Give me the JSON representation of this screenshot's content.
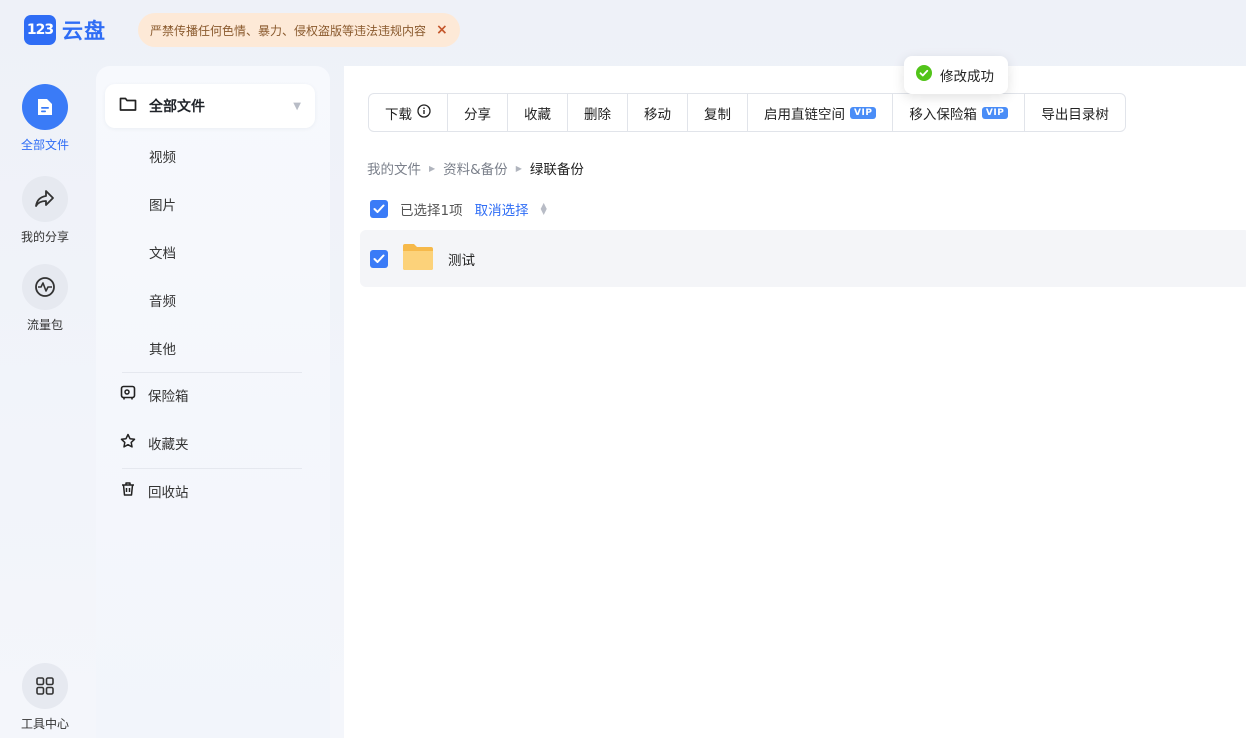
{
  "header": {
    "logo_badge": "123",
    "logo_text": "云盘",
    "notice": "严禁传播任何色情、暴力、侵权盗版等违法违规内容",
    "notice_close": "×"
  },
  "rail": {
    "items": [
      {
        "label": "全部文件",
        "icon": "folder-file-icon",
        "active": true
      },
      {
        "label": "我的分享",
        "icon": "share-arrow-icon",
        "active": false
      },
      {
        "label": "流量包",
        "icon": "traffic-pulse-icon",
        "active": false
      }
    ],
    "bottom": {
      "label": "工具中心",
      "icon": "grid-icon"
    }
  },
  "subnav": {
    "head": {
      "label": "全部文件",
      "icon": "folder-icon"
    },
    "children": [
      "视频",
      "图片",
      "文档",
      "音频",
      "其他"
    ],
    "extras": [
      {
        "label": "保险箱",
        "icon": "safe-icon"
      },
      {
        "label": "收藏夹",
        "icon": "star-icon"
      },
      {
        "label": "回收站",
        "icon": "trash-icon"
      }
    ]
  },
  "toolbar": {
    "buttons": [
      {
        "label": "下载",
        "suffix_icon": "info-icon"
      },
      {
        "label": "分享"
      },
      {
        "label": "收藏"
      },
      {
        "label": "删除"
      },
      {
        "label": "移动"
      },
      {
        "label": "复制"
      },
      {
        "label": "启用直链空间",
        "vip": "VIP"
      },
      {
        "label": "移入保险箱",
        "vip": "VIP"
      },
      {
        "label": "导出目录树"
      }
    ]
  },
  "toast": {
    "text": "修改成功",
    "icon": "success-check-icon"
  },
  "breadcrumb": [
    "我的文件",
    "资料&备份",
    "绿联备份"
  ],
  "selection": {
    "count_text": "已选择1项",
    "cancel_text": "取消选择"
  },
  "files": [
    {
      "name": "测试",
      "type": "folder",
      "checked": true
    }
  ],
  "colors": {
    "accent": "#3a7bf7",
    "notice_bg": "#fde9d7",
    "toast_success": "#52c41a",
    "folder": "#f9c55a"
  }
}
